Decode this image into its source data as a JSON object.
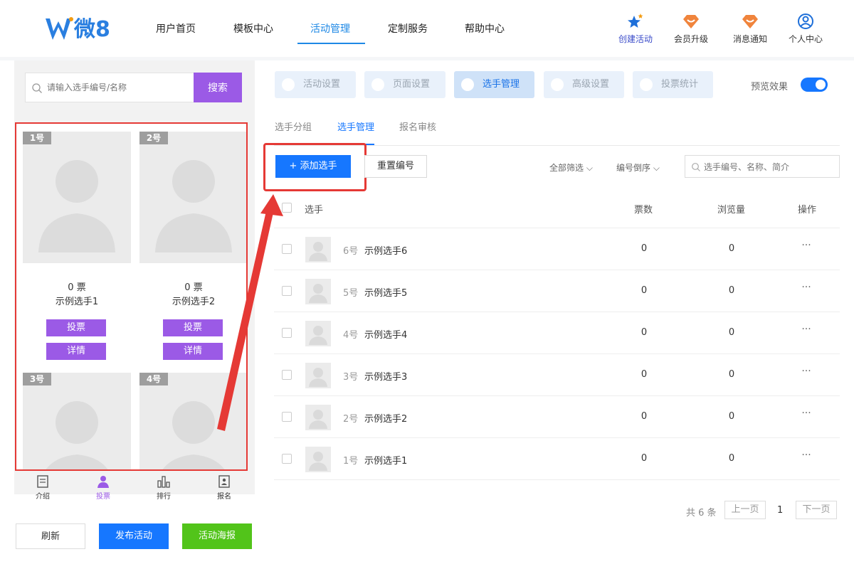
{
  "brand": {
    "logo_text": "微8"
  },
  "nav": {
    "items": [
      "用户首页",
      "模板中心",
      "活动管理",
      "定制服务",
      "帮助中心"
    ],
    "active_index": 2
  },
  "top_actions": [
    "创建活动",
    "会员升级",
    "消息通知",
    "个人中心"
  ],
  "left": {
    "search_placeholder": "请输入选手编号/名称",
    "search_button": "搜索",
    "cards": [
      {
        "num": "1号",
        "votes": "0 票",
        "name": "示例选手1",
        "vote_btn": "投票",
        "detail_btn": "详情"
      },
      {
        "num": "2号",
        "votes": "0 票",
        "name": "示例选手2",
        "vote_btn": "投票",
        "detail_btn": "详情"
      },
      {
        "num": "3号"
      },
      {
        "num": "4号"
      }
    ],
    "bottom_tabs": [
      "介绍",
      "投票",
      "排行",
      "报名"
    ],
    "bottom_active_index": 1,
    "actions": {
      "refresh": "刷新",
      "publish": "发布活动",
      "poster": "活动海报"
    }
  },
  "right": {
    "steps": [
      "活动设置",
      "页面设置",
      "选手管理",
      "高级设置",
      "投票统计"
    ],
    "active_step": 2,
    "preview_label": "预览效果",
    "preview_on": true,
    "subtabs": [
      "选手分组",
      "选手管理",
      "报名审核"
    ],
    "active_subtab": 1,
    "toolbar": {
      "add_button": "+ 添加选手",
      "renumber_button": "重置编号",
      "filter_all": "全部筛选",
      "sort": "编号倒序",
      "search_placeholder": "选手编号、名称、简介"
    },
    "table": {
      "headers": {
        "player": "选手",
        "votes": "票数",
        "views": "浏览量",
        "ops": "操作"
      },
      "rows": [
        {
          "num": "6号",
          "name": "示例选手6",
          "votes": "0",
          "views": "0",
          "more": "···"
        },
        {
          "num": "5号",
          "name": "示例选手5",
          "votes": "0",
          "views": "0",
          "more": "···"
        },
        {
          "num": "4号",
          "name": "示例选手4",
          "votes": "0",
          "views": "0",
          "more": "···"
        },
        {
          "num": "3号",
          "name": "示例选手3",
          "votes": "0",
          "views": "0",
          "more": "···"
        },
        {
          "num": "2号",
          "name": "示例选手2",
          "votes": "0",
          "views": "0",
          "more": "···"
        },
        {
          "num": "1号",
          "name": "示例选手1",
          "votes": "0",
          "views": "0",
          "more": "···"
        }
      ]
    },
    "pager": {
      "total": "共 6 条",
      "prev": "上一页",
      "current": "1",
      "next": "下一页"
    }
  },
  "colors": {
    "accent_blue": "#1677ff",
    "purple": "#9b5ae6",
    "green": "#52c41a",
    "annotation_red": "#e53935"
  }
}
